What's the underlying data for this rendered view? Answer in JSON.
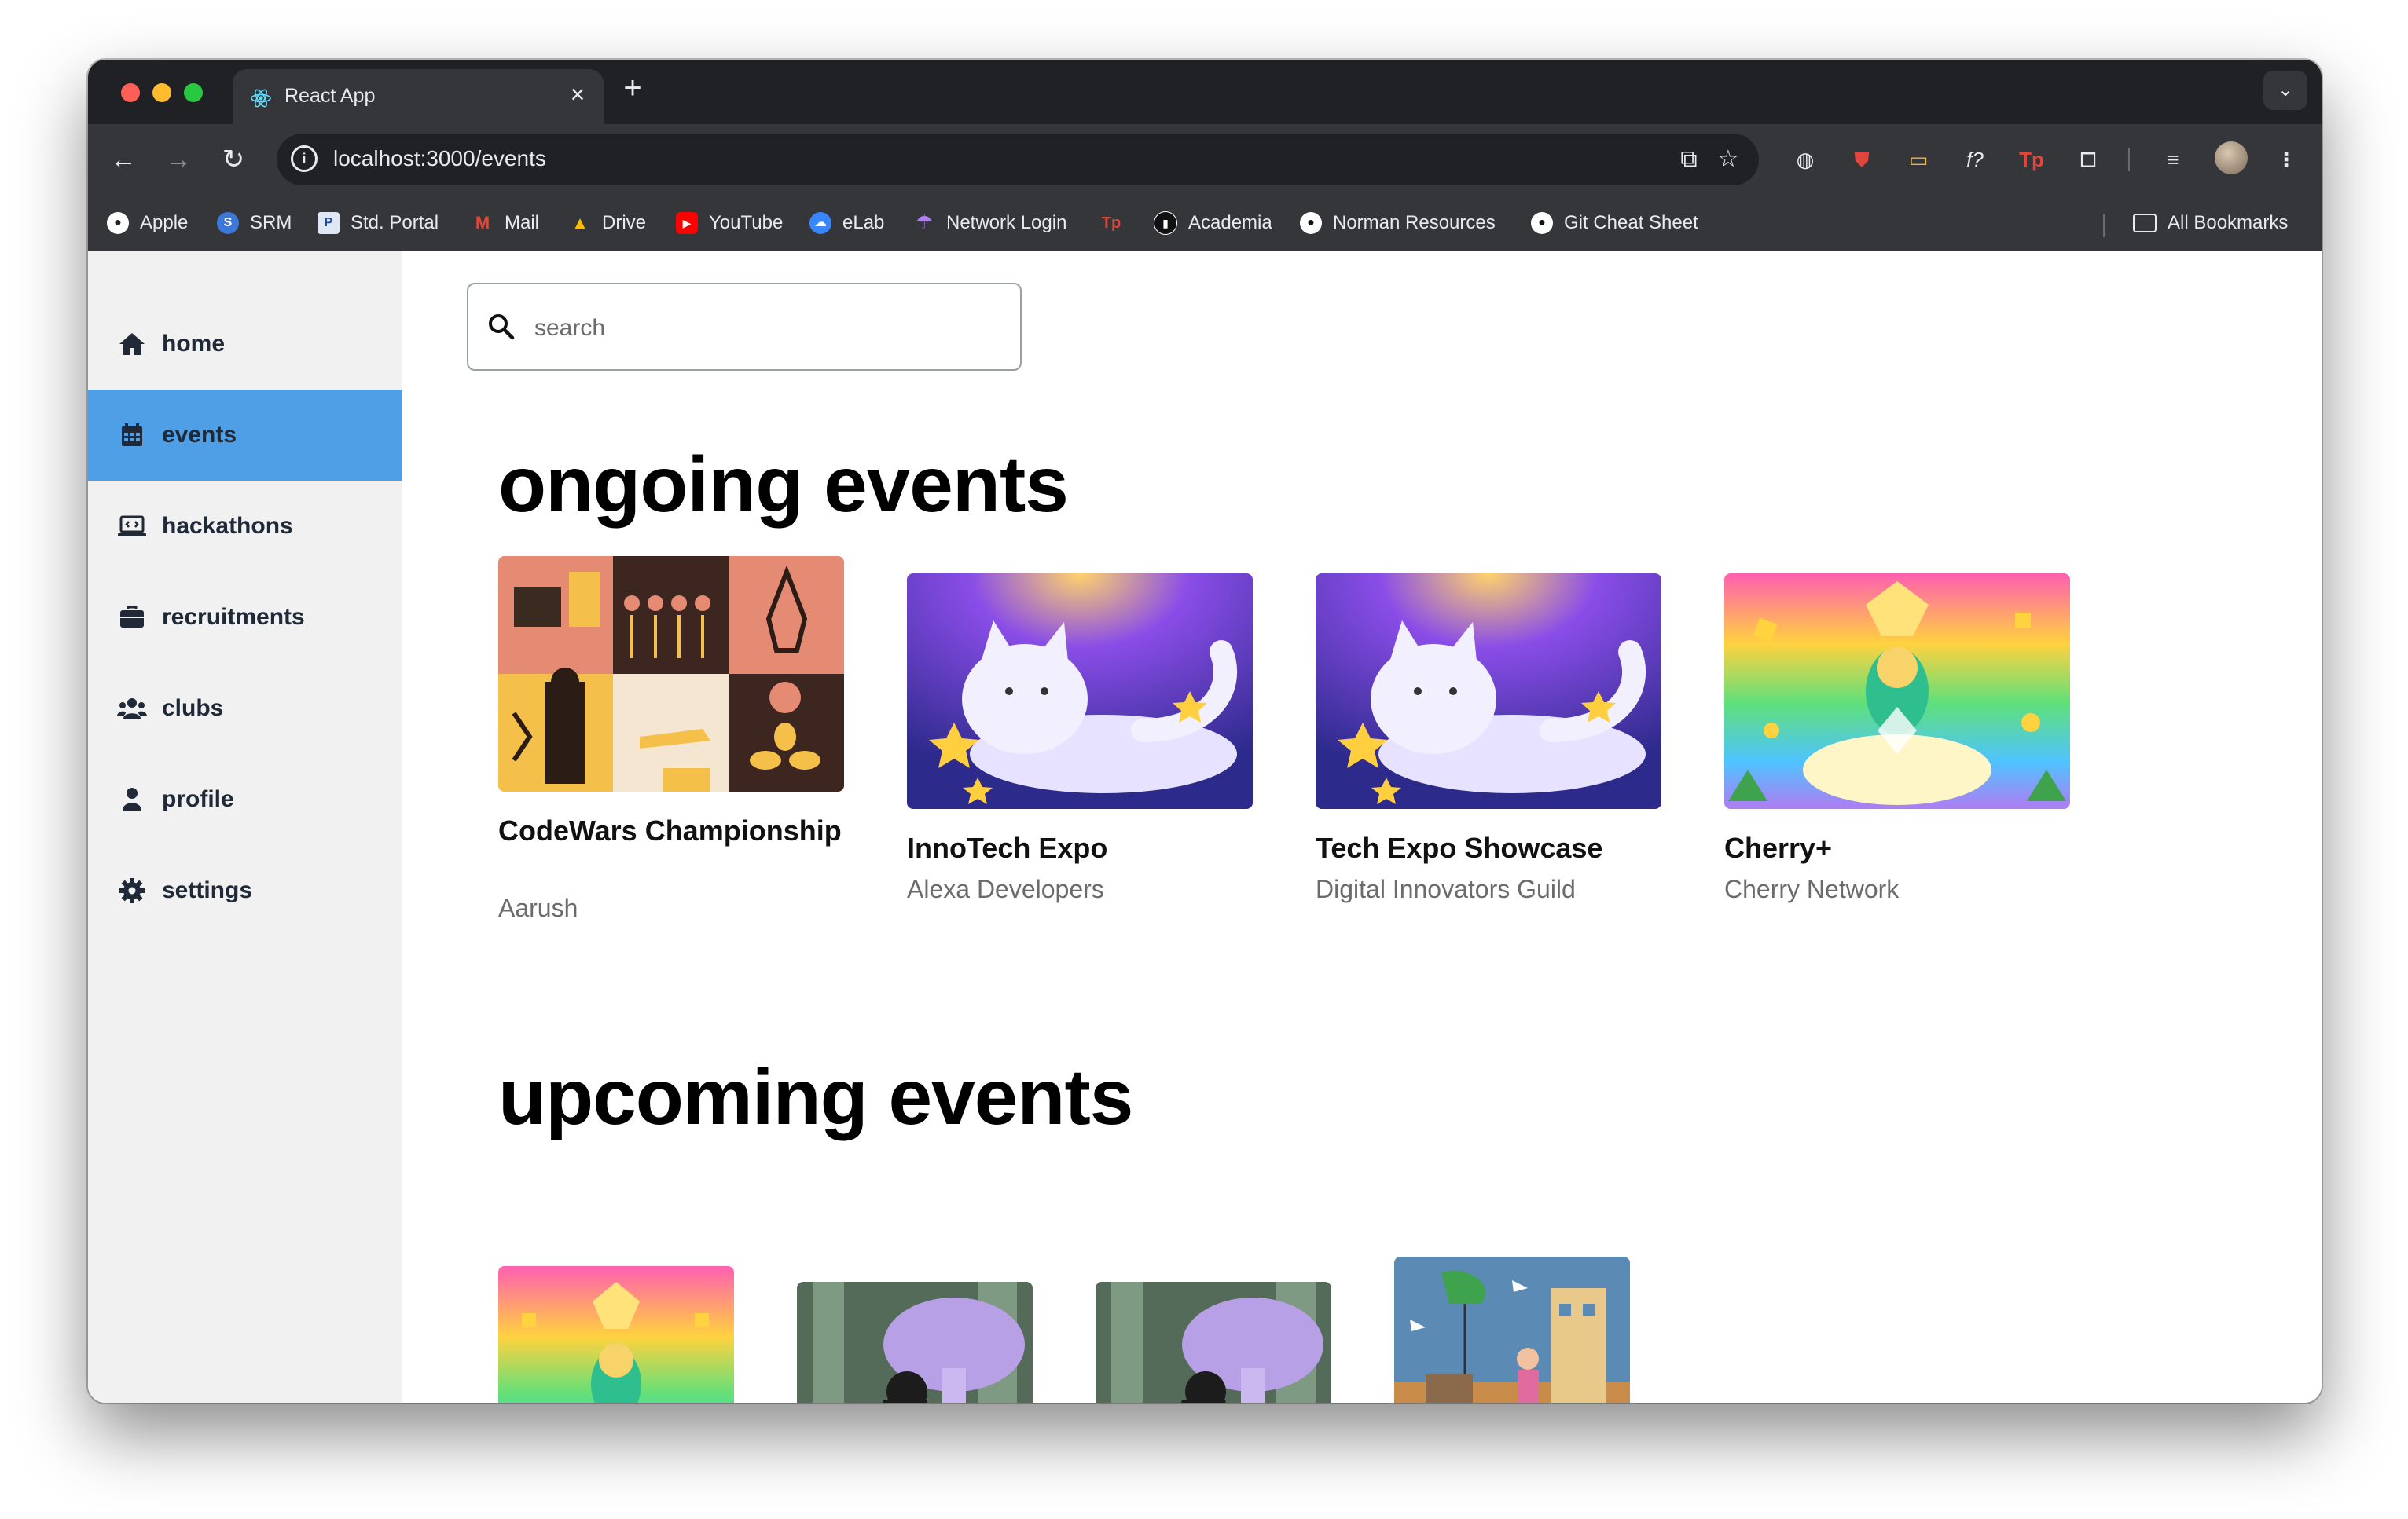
{
  "browser": {
    "tab_title": "React App",
    "url": "localhost:3000/events",
    "bookmarks": [
      {
        "label": "Apple",
        "icon": "apple-icon"
      },
      {
        "label": "SRM",
        "icon": "srm-icon"
      },
      {
        "label": "Std. Portal",
        "icon": "portal-icon"
      },
      {
        "label": "Mail",
        "icon": "gmail-icon"
      },
      {
        "label": "Drive",
        "icon": "drive-icon"
      },
      {
        "label": "YouTube",
        "icon": "youtube-icon"
      },
      {
        "label": "eLab",
        "icon": "cloud-icon"
      },
      {
        "label": "Network Login",
        "icon": "umbrella-icon"
      },
      {
        "label": "",
        "icon": "tp-icon"
      },
      {
        "label": "Academia",
        "icon": "academia-icon"
      },
      {
        "label": "Norman Resources",
        "icon": "github-icon"
      },
      {
        "label": "Git Cheat Sheet",
        "icon": "github-icon"
      }
    ],
    "all_bookmarks": "All Bookmarks"
  },
  "sidebar": {
    "items": [
      {
        "label": "home",
        "icon": "home-icon",
        "active": false
      },
      {
        "label": "events",
        "icon": "calendar-icon",
        "active": true
      },
      {
        "label": "hackathons",
        "icon": "laptop-code-icon",
        "active": false
      },
      {
        "label": "recruitments",
        "icon": "briefcase-icon",
        "active": false
      },
      {
        "label": "clubs",
        "icon": "users-icon",
        "active": false
      },
      {
        "label": "profile",
        "icon": "user-icon",
        "active": false
      },
      {
        "label": "settings",
        "icon": "gear-icon",
        "active": false
      }
    ]
  },
  "search": {
    "placeholder": "search",
    "value": ""
  },
  "ongoing": {
    "title": "ongoing events",
    "events": [
      {
        "title": "CodeWars Championship",
        "organizer": "Aarush",
        "image": "illustration-grid"
      },
      {
        "title": "InnoTech Expo",
        "organizer": "Alexa Developers",
        "image": "illustration-cat"
      },
      {
        "title": "Tech Expo Showcase",
        "organizer": "Digital Innovators Guild",
        "image": "illustration-cat"
      },
      {
        "title": "Cherry+",
        "organizer": "Cherry Network",
        "image": "illustration-rainbow"
      }
    ]
  },
  "upcoming": {
    "title": "upcoming events",
    "events": [
      {
        "image": "illustration-rainbow"
      },
      {
        "image": "illustration-mushroom"
      },
      {
        "image": "illustration-mushroom"
      },
      {
        "image": "illustration-city"
      }
    ]
  },
  "colors": {
    "accent": "#4f9fe6",
    "sidebar_bg": "#f1f1f2",
    "browser_dark": "#202124",
    "browser_toolbar": "#35363a"
  }
}
